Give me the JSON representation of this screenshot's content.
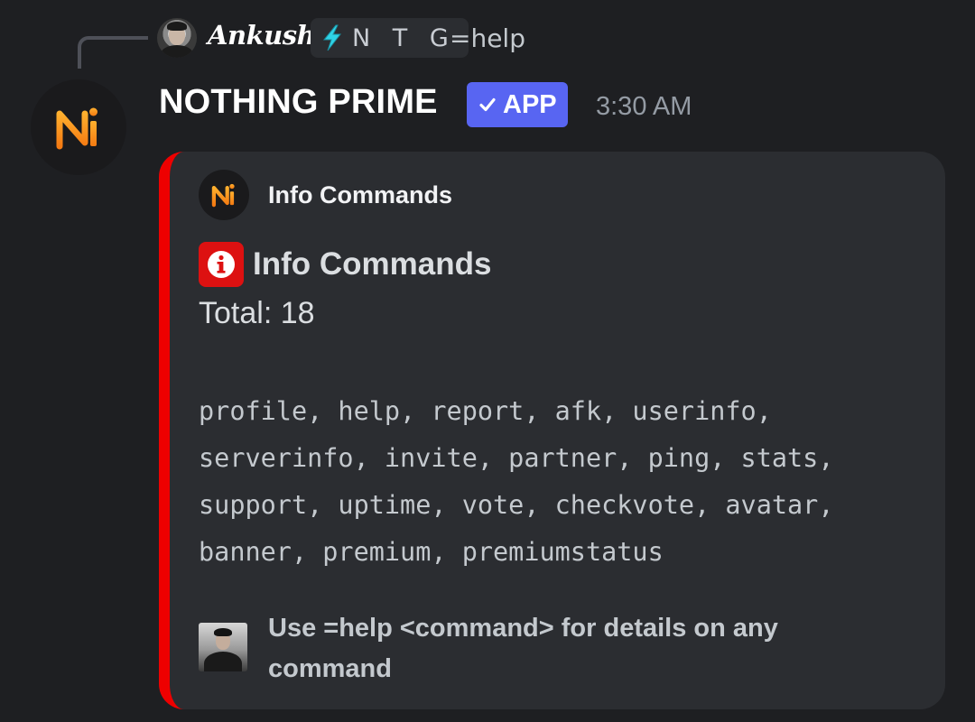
{
  "reply": {
    "author": "Ankush",
    "tag_text": "N T G",
    "tag_icon": "lightning-bolt-icon",
    "content": "=help"
  },
  "message": {
    "bot_name": "NOTHING PRIME",
    "badge_label": "APP",
    "badge_color": "#5865f2",
    "timestamp": "3:30 AM"
  },
  "embed": {
    "accent_color": "#ee0000",
    "author_name": "Info Commands",
    "title": "Info Commands",
    "title_icon": "info-icon",
    "total": "Total: 18",
    "commands": "profile, help, report, afk, userinfo, serverinfo, invite, partner, ping, stats, support, uptime, vote, checkvote, avatar, banner, premium, premiumstatus",
    "footer": "Use =help <command> for details on any command"
  },
  "colors": {
    "background": "#1e1f22",
    "embed_background": "#2b2d31",
    "logo_orange": "#f7941d"
  }
}
